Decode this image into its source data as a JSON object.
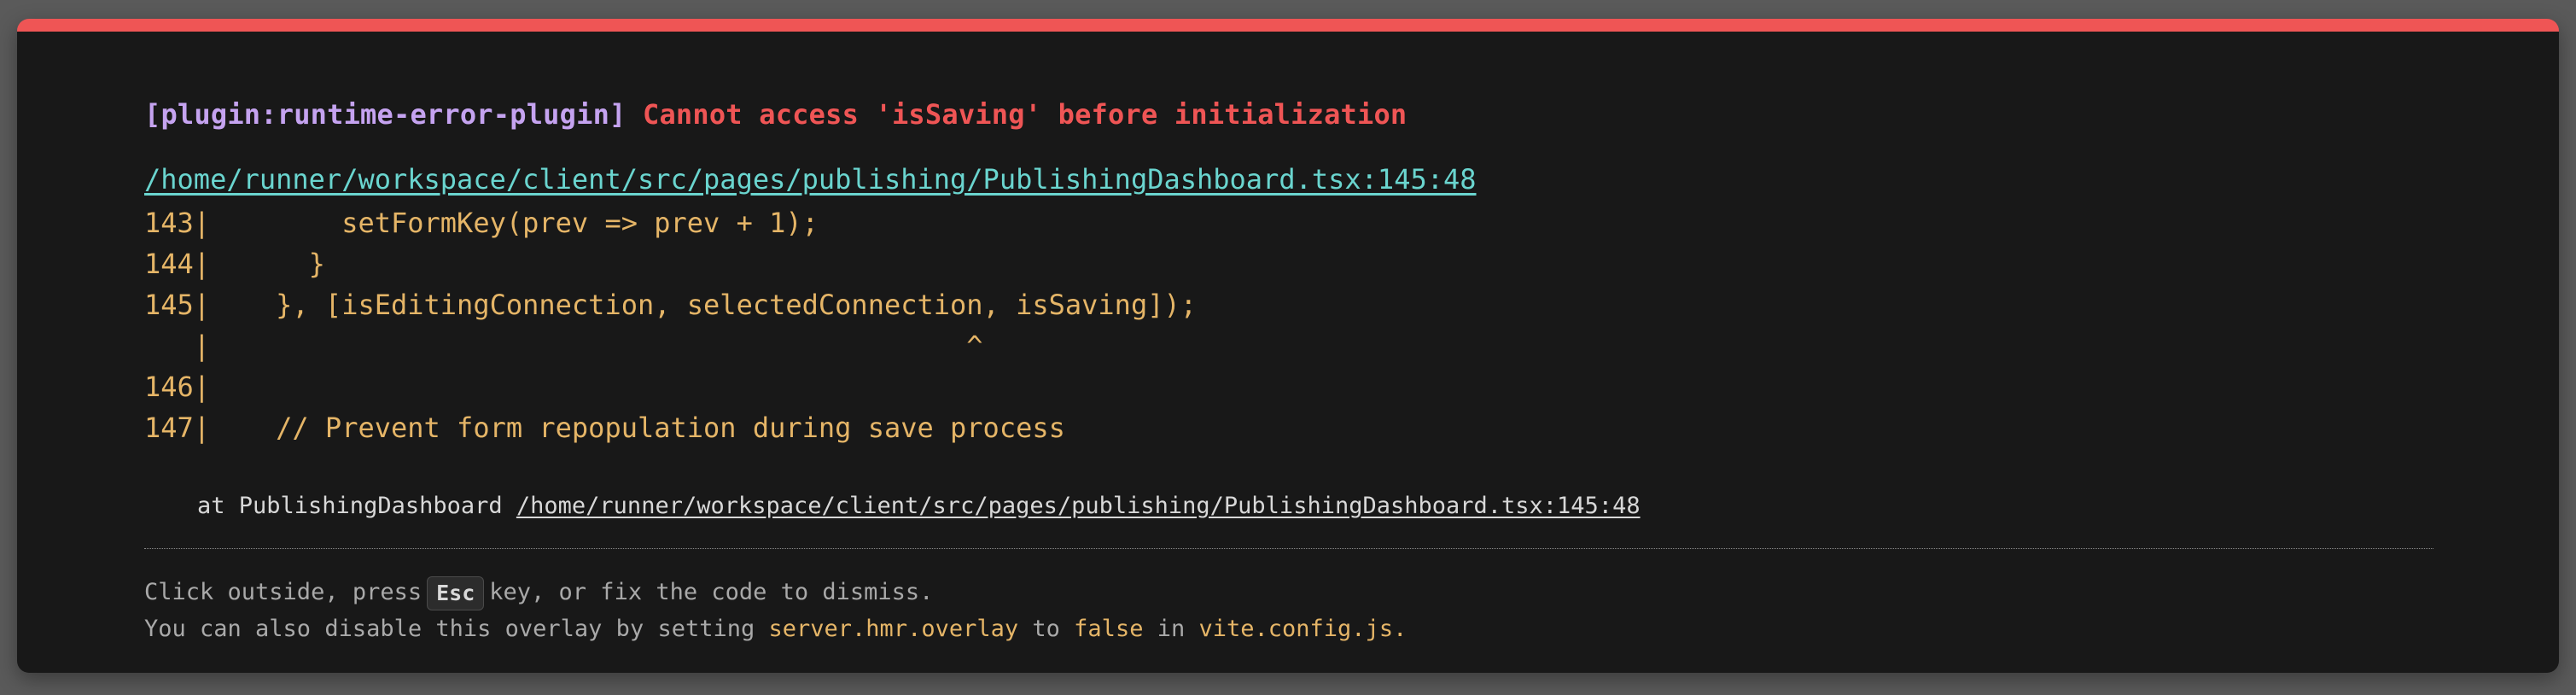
{
  "error_overlay": {
    "plugin_label": "[plugin:runtime-error-plugin]",
    "message": "Cannot access 'isSaving' before initialization",
    "file_link": "/home/runner/workspace/client/src/pages/publishing/PublishingDashboard.tsx:145:48",
    "code_frame": [
      "143|        setFormKey(prev => prev + 1);",
      "144|      }",
      "145|    }, [isEditingConnection, selectedConnection, isSaving]);",
      "   |                                              ^",
      "146|",
      "147|    // Prevent form repopulation during save process"
    ],
    "stack": {
      "prefix": "at PublishingDashboard",
      "link": "/home/runner/workspace/client/src/pages/publishing/PublishingDashboard.tsx:145:48"
    },
    "tip": {
      "line1_before": "Click outside, press",
      "key": "Esc",
      "line1_after": "key, or fix the code to dismiss.",
      "line2_prefix": "You can also disable this overlay by setting",
      "setting": "server.hmr.overlay",
      "to_word": "to",
      "value": "false",
      "in_word": "in",
      "config_file": "vite.config.js."
    }
  },
  "colors": {
    "accent_bar": "#ef5555",
    "plugin": "#c5a3f0",
    "message": "#ef5555",
    "link": "#6ad5cf",
    "code": "#e5b567",
    "background": "#181818"
  }
}
